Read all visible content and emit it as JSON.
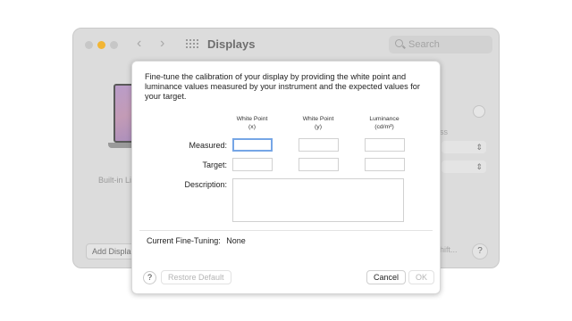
{
  "window": {
    "title": "Displays",
    "search_placeholder": "Search",
    "builtin_label": "Built-in Li",
    "partial_ss": "ss",
    "add_display_label": "Add Displa",
    "night_shift_partial": "hift...",
    "help_label": "?"
  },
  "dialog": {
    "intro": "Fine-tune the calibration of your display by providing the white point and luminance values measured by your instrument and the expected values for your target.",
    "columns": [
      {
        "title": "White Point",
        "unit": "(x)"
      },
      {
        "title": "White Point",
        "unit": "(y)"
      },
      {
        "title": "Luminance",
        "unit": "(cd/m²)"
      }
    ],
    "rows": {
      "measured_label": "Measured:",
      "target_label": "Target:",
      "description_label": "Description:"
    },
    "values": {
      "measured": [
        "",
        "",
        ""
      ],
      "target": [
        "",
        "",
        ""
      ],
      "description": ""
    },
    "current": {
      "label": "Current Fine-Tuning:",
      "value": "None"
    },
    "buttons": {
      "help": "?",
      "restore": "Restore Default",
      "cancel": "Cancel",
      "ok": "OK"
    }
  }
}
